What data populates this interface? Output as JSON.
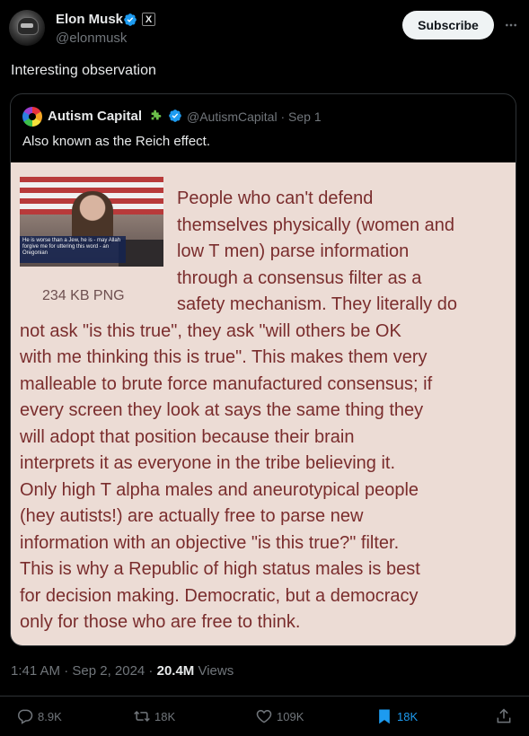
{
  "author": {
    "name": "Elon Musk",
    "handle": "@elonmusk",
    "avatar_icon": "helmet-avatar-icon",
    "badge_icon": "x-affiliate-badge-icon"
  },
  "actions_top": {
    "subscribe_label": "Subscribe",
    "more_icon": "more-horizontal-icon"
  },
  "tweet": {
    "text": "Interesting observation"
  },
  "quoted": {
    "name": "Autism Capital",
    "emoji_icon": "puzzle-piece-icon",
    "handle_date": "@AutismCapital · Sep 1",
    "text": "Also known as the Reich effect.",
    "image": {
      "inset_caption": "He is worse than a Jew, he is - may Allah forgive me for uttering this word - an Oregonian",
      "file_size": "234 KB PNG",
      "lines": [
        "People who can't defend",
        "themselves physically (women and",
        "low T men) parse information",
        "through a consensus filter as a",
        "safety mechanism. They literally do",
        "not ask \"is this true\", they ask \"will others be OK",
        "with me thinking this is true\". This makes them very",
        "malleable to brute force manufactured consensus; if",
        "every screen they look at says the same thing they",
        "will adopt that position because their brain",
        "interprets it as everyone in the tribe believing it.",
        "Only high T alpha males and aneurotypical people",
        "(hey autists!) are actually free to parse new",
        "information with an objective \"is this true?\" filter.",
        "This is why a Republic of high status males is best",
        "for decision making. Democratic, but a democracy",
        "only for those who are free to think."
      ]
    }
  },
  "meta": {
    "time_date": "1:41 AM · Sep 2, 2024 · ",
    "views_count": "20.4M",
    "views_label": " Views"
  },
  "stats": {
    "replies": "8.9K",
    "reposts": "18K",
    "likes": "109K",
    "bookmarks": "18K"
  },
  "colors": {
    "background": "#000000",
    "accent": "#1d9bf0",
    "muted": "#71767b",
    "image_bg": "#ecdcd5",
    "image_text": "#7a2d2d"
  }
}
